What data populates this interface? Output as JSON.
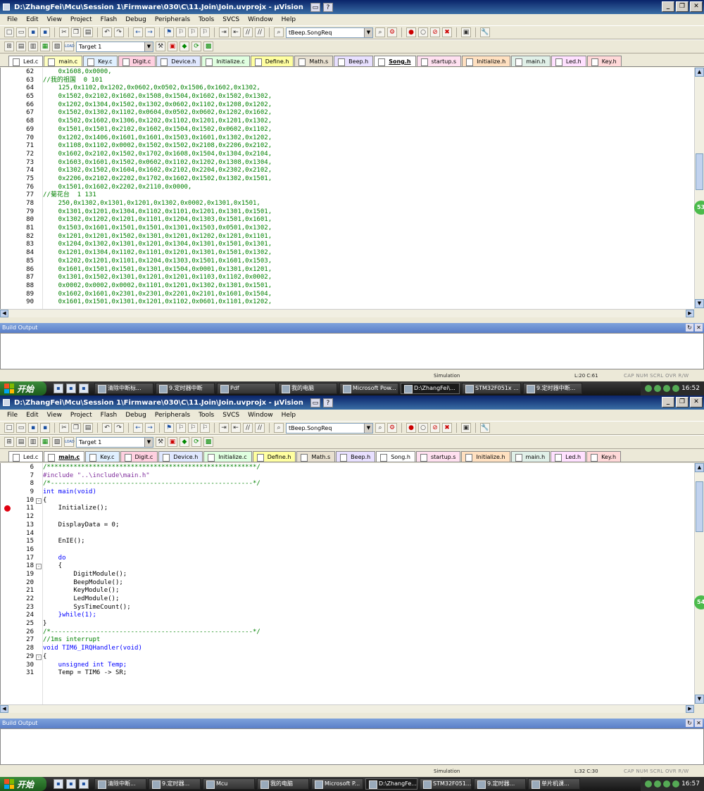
{
  "windows": [
    {
      "title": "D:\\ZhangFei\\Mcu\\Session 1\\Firmware\\030\\C\\11.Join\\Join.uvprojx - µVision",
      "menu": [
        "File",
        "Edit",
        "View",
        "Project",
        "Flash",
        "Debug",
        "Peripherals",
        "Tools",
        "SVCS",
        "Window",
        "Help"
      ],
      "function_combo": "tBeep.SongReq",
      "target_combo": "Target 1",
      "tabs": [
        {
          "label": "Led.c",
          "color": "#ffffff",
          "active": false
        },
        {
          "label": "main.c",
          "color": "#ffffc0",
          "active": false
        },
        {
          "label": "Key.c",
          "color": "#e0f0ff",
          "active": false
        },
        {
          "label": "Digit.c",
          "color": "#ffd0e0",
          "active": false
        },
        {
          "label": "Device.h",
          "color": "#e0e8ff",
          "active": false
        },
        {
          "label": "Initialize.c",
          "color": "#e0ffe0",
          "active": false
        },
        {
          "label": "Define.h",
          "color": "#ffffa0",
          "active": false
        },
        {
          "label": "Math.s",
          "color": "#e8e0d0",
          "active": false
        },
        {
          "label": "Beep.h",
          "color": "#e8e0ff",
          "active": false
        },
        {
          "label": "Song.h",
          "color": "#ffffff",
          "active": true
        },
        {
          "label": "startup.s",
          "color": "#ffe0f0",
          "active": false
        },
        {
          "label": "Initialize.h",
          "color": "#ffe0c0",
          "active": false
        },
        {
          "label": "main.h",
          "color": "#e0f0e8",
          "active": false
        },
        {
          "label": "Led.h",
          "color": "#ffe0ff",
          "active": false
        },
        {
          "label": "Key.h",
          "color": "#ffd8d8",
          "active": false
        }
      ],
      "code_lines": [
        {
          "n": "62",
          "text": "    0x1608,0x0000,",
          "cls": "c-cm"
        },
        {
          "n": "63",
          "text": "//我的祖国  0 101",
          "cls": "c-cm"
        },
        {
          "n": "64",
          "text": "    125,0x1102,0x1202,0x0602,0x0502,0x1506,0x1602,0x1302,",
          "cls": "c-cm"
        },
        {
          "n": "65",
          "text": "    0x1502,0x2102,0x1602,0x1508,0x1504,0x1602,0x1502,0x1302,",
          "cls": "c-cm"
        },
        {
          "n": "66",
          "text": "    0x1202,0x1304,0x1502,0x1302,0x0602,0x1102,0x1208,0x1202,",
          "cls": "c-cm"
        },
        {
          "n": "67",
          "text": "    0x1502,0x1302,0x1102,0x0604,0x0502,0x0602,0x1202,0x1602,",
          "cls": "c-cm"
        },
        {
          "n": "68",
          "text": "    0x1502,0x1602,0x1306,0x1202,0x1102,0x1201,0x1201,0x1302,",
          "cls": "c-cm"
        },
        {
          "n": "69",
          "text": "    0x1501,0x1501,0x2102,0x1602,0x1504,0x1502,0x0602,0x1102,",
          "cls": "c-cm"
        },
        {
          "n": "70",
          "text": "    0x1202,0x1406,0x1601,0x1601,0x1503,0x1601,0x1302,0x1202,",
          "cls": "c-cm"
        },
        {
          "n": "71",
          "text": "    0x1108,0x1102,0x0002,0x1502,0x1502,0x2108,0x2206,0x2102,",
          "cls": "c-cm"
        },
        {
          "n": "72",
          "text": "    0x1602,0x2102,0x1502,0x1702,0x1608,0x1504,0x1304,0x2104,",
          "cls": "c-cm"
        },
        {
          "n": "73",
          "text": "    0x1603,0x1601,0x1502,0x0602,0x1102,0x1202,0x1308,0x1304,",
          "cls": "c-cm"
        },
        {
          "n": "74",
          "text": "    0x1302,0x1502,0x1604,0x1602,0x2102,0x2204,0x2302,0x2102,",
          "cls": "c-cm"
        },
        {
          "n": "75",
          "text": "    0x2206,0x2102,0x2202,0x1702,0x1602,0x1502,0x1302,0x1501,",
          "cls": "c-cm"
        },
        {
          "n": "76",
          "text": "    0x1501,0x1602,0x2202,0x2110,0x0000,",
          "cls": "c-cm"
        },
        {
          "n": "77",
          "text": "//菊花台  1 131",
          "cls": "c-cm"
        },
        {
          "n": "78",
          "text": "    250,0x1302,0x1301,0x1201,0x1302,0x0002,0x1301,0x1501,",
          "cls": "c-cm"
        },
        {
          "n": "79",
          "text": "    0x1301,0x1201,0x1304,0x1102,0x1101,0x1201,0x1301,0x1501,",
          "cls": "c-cm"
        },
        {
          "n": "80",
          "text": "    0x1302,0x1202,0x1201,0x1101,0x1204,0x1303,0x1501,0x1601,",
          "cls": "c-cm"
        },
        {
          "n": "81",
          "text": "    0x1503,0x1601,0x1501,0x1501,0x1301,0x1503,0x0501,0x1302,",
          "cls": "c-cm"
        },
        {
          "n": "82",
          "text": "    0x1201,0x1201,0x1502,0x1301,0x1201,0x1202,0x1201,0x1101,",
          "cls": "c-cm"
        },
        {
          "n": "83",
          "text": "    0x1204,0x1302,0x1301,0x1201,0x1304,0x1301,0x1501,0x1301,",
          "cls": "c-cm"
        },
        {
          "n": "84",
          "text": "    0x1201,0x1304,0x1102,0x1101,0x1201,0x1301,0x1501,0x1302,",
          "cls": "c-cm"
        },
        {
          "n": "85",
          "text": "    0x1202,0x1201,0x1101,0x1204,0x1303,0x1501,0x1601,0x1503,",
          "cls": "c-cm"
        },
        {
          "n": "86",
          "text": "    0x1601,0x1501,0x1501,0x1301,0x1504,0x0001,0x1301,0x1201,",
          "cls": "c-cm"
        },
        {
          "n": "87",
          "text": "    0x1301,0x1502,0x1301,0x1201,0x1201,0x1103,0x1102,0x0002,",
          "cls": "c-cm"
        },
        {
          "n": "88",
          "text": "    0x0002,0x0002,0x0002,0x1101,0x1201,0x1302,0x1301,0x1501,",
          "cls": "c-cm"
        },
        {
          "n": "89",
          "text": "    0x1602,0x1601,0x2301,0x2301,0x2201,0x2101,0x1601,0x1504,",
          "cls": "c-cm"
        },
        {
          "n": "90",
          "text": "    0x1601,0x1501,0x1301,0x1201,0x1102,0x0601,0x1101,0x1202,",
          "cls": "c-cm"
        }
      ],
      "build_output_label": "Build Output",
      "status": {
        "mode": "Simulation",
        "pos": "L:20 C:61",
        "keys": "CAP  NUM  SCRL  OVR  R/W"
      },
      "badge": "53",
      "taskbar": {
        "start": "开始",
        "tasks": [
          {
            "label": "清除中断标...",
            "w": 84
          },
          {
            "label": "9.定时器中断",
            "w": 84
          },
          {
            "label": "Pdf",
            "w": 84
          },
          {
            "label": "我的电脑",
            "w": 84
          },
          {
            "label": "Microsoft Pow...",
            "w": 84
          },
          {
            "label": "D:\\ZhangFei\\...",
            "w": 84,
            "active": true
          },
          {
            "label": "STM32F051x ...",
            "w": 84
          },
          {
            "label": "9.定时器中断...",
            "w": 84
          }
        ],
        "clock": "16:52"
      }
    },
    {
      "title": "D:\\ZhangFei\\Mcu\\Session 1\\Firmware\\030\\C\\11.Join\\Join.uvprojx - µVision",
      "menu": [
        "File",
        "Edit",
        "View",
        "Project",
        "Flash",
        "Debug",
        "Peripherals",
        "Tools",
        "SVCS",
        "Window",
        "Help"
      ],
      "function_combo": "tBeep.SongReq",
      "target_combo": "Target 1",
      "tabs": [
        {
          "label": "Led.c",
          "color": "#ffffff",
          "active": false
        },
        {
          "label": "main.c",
          "color": "#ffffc0",
          "active": true
        },
        {
          "label": "Key.c",
          "color": "#e0f0ff",
          "active": false
        },
        {
          "label": "Digit.c",
          "color": "#ffd0e0",
          "active": false
        },
        {
          "label": "Device.h",
          "color": "#e0e8ff",
          "active": false
        },
        {
          "label": "Initialize.c",
          "color": "#e0ffe0",
          "active": false
        },
        {
          "label": "Define.h",
          "color": "#ffffa0",
          "active": false
        },
        {
          "label": "Math.s",
          "color": "#e8e0d0",
          "active": false
        },
        {
          "label": "Beep.h",
          "color": "#e8e0ff",
          "active": false
        },
        {
          "label": "Song.h",
          "color": "#ffffff",
          "active": false
        },
        {
          "label": "startup.s",
          "color": "#ffe0f0",
          "active": false
        },
        {
          "label": "Initialize.h",
          "color": "#ffe0c0",
          "active": false
        },
        {
          "label": "main.h",
          "color": "#e0f0e8",
          "active": false
        },
        {
          "label": "Led.h",
          "color": "#ffe0ff",
          "active": false
        },
        {
          "label": "Key.h",
          "color": "#ffd8d8",
          "active": false
        }
      ],
      "code_lines": [
        {
          "n": "6",
          "text": "/*******************************************************/",
          "cls": "c-cm"
        },
        {
          "n": "7",
          "text": "#include \"..\\include\\main.h\"",
          "cls": "c-pp"
        },
        {
          "n": "8",
          "text": "/*-----------------------------------------------------*/",
          "cls": "c-cm"
        },
        {
          "n": "9",
          "text": "int main(void)",
          "cls": "c-kw"
        },
        {
          "n": "10",
          "text": "{",
          "cls": "c-tx",
          "fold": "-"
        },
        {
          "n": "11",
          "text": "    Initialize();",
          "cls": "c-tx",
          "bp": true
        },
        {
          "n": "12",
          "text": "",
          "cls": "c-tx"
        },
        {
          "n": "13",
          "text": "    DisplayData = 0;",
          "cls": "c-tx"
        },
        {
          "n": "14",
          "text": "",
          "cls": "c-tx"
        },
        {
          "n": "15",
          "text": "    EnIE();",
          "cls": "c-tx"
        },
        {
          "n": "16",
          "text": "",
          "cls": "c-tx"
        },
        {
          "n": "17",
          "text": "    do",
          "cls": "c-kw"
        },
        {
          "n": "18",
          "text": "    {",
          "cls": "c-tx",
          "fold": "-"
        },
        {
          "n": "19",
          "text": "        DigitModule();",
          "cls": "c-tx"
        },
        {
          "n": "20",
          "text": "        BeepModule();",
          "cls": "c-tx"
        },
        {
          "n": "21",
          "text": "        KeyModule();",
          "cls": "c-tx"
        },
        {
          "n": "22",
          "text": "        LedModule();",
          "cls": "c-tx"
        },
        {
          "n": "23",
          "text": "        SysTimeCount();",
          "cls": "c-tx"
        },
        {
          "n": "24",
          "text": "    }while(1);",
          "cls": "c-kw"
        },
        {
          "n": "25",
          "text": "}",
          "cls": "c-tx"
        },
        {
          "n": "26",
          "text": "/*-----------------------------------------------------*/",
          "cls": "c-cm"
        },
        {
          "n": "27",
          "text": "//1ms interrupt",
          "cls": "c-cm"
        },
        {
          "n": "28",
          "text": "void TIM6_IRQHandler(void)",
          "cls": "c-kw"
        },
        {
          "n": "29",
          "text": "{",
          "cls": "c-tx",
          "fold": "-"
        },
        {
          "n": "30",
          "text": "    unsigned int Temp;",
          "cls": "c-kw"
        },
        {
          "n": "31",
          "text": "    Temp = TIM6 -> SR;",
          "cls": "c-tx"
        }
      ],
      "build_output_label": "Build Output",
      "status": {
        "mode": "Simulation",
        "pos": "L:32 C:30",
        "keys": "CAP  NUM  SCRL  OVR  R/W"
      },
      "badge": "54",
      "taskbar": {
        "start": "开始",
        "tasks": [
          {
            "label": "清除中断...",
            "w": 74
          },
          {
            "label": "9.定时器...",
            "w": 74
          },
          {
            "label": "Mcu",
            "w": 74
          },
          {
            "label": "我的电脑",
            "w": 74
          },
          {
            "label": "Microsoft P...",
            "w": 74
          },
          {
            "label": "D:\\ZhangFe...",
            "w": 74,
            "active": true
          },
          {
            "label": "STM32F051...",
            "w": 74
          },
          {
            "label": "9.定时器...",
            "w": 74
          },
          {
            "label": "单片机课...",
            "w": 74
          }
        ],
        "clock": "16:57"
      }
    }
  ]
}
